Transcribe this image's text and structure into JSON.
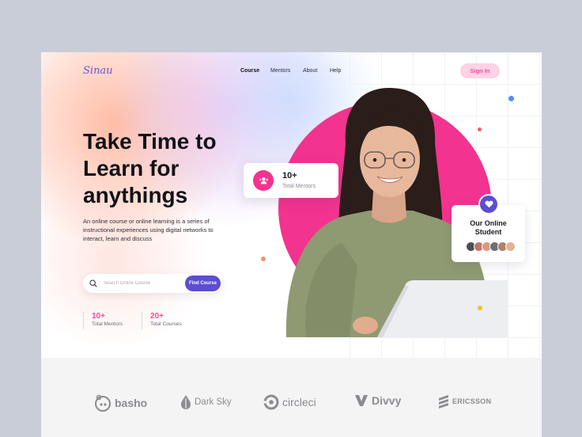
{
  "header": {
    "logo": "Sinau",
    "nav": [
      {
        "label": "Course",
        "active": true
      },
      {
        "label": "Mentors",
        "active": false
      },
      {
        "label": "About",
        "active": false
      },
      {
        "label": "Help",
        "active": false
      }
    ],
    "signin_label": "Sign In"
  },
  "hero": {
    "title_line1": "Take Time to",
    "title_line2": "Learn for",
    "title_line3": "anythings",
    "description": "An online course or online learning is a series of instructional experiences using digital networks to interact, learn and discuss"
  },
  "search": {
    "placeholder": "Search Online Course",
    "button_label": "Find Course"
  },
  "stats": [
    {
      "value": "10+",
      "label": "Total Mentors"
    },
    {
      "value": "20+",
      "label": "Total Courses"
    }
  ],
  "mentors_card": {
    "value": "10+",
    "label": "Total Mentors",
    "icon": "group-icon"
  },
  "online_card": {
    "title_line1": "Our Online",
    "title_line2": "Student",
    "icon": "heart-icon"
  },
  "brands": [
    {
      "name": "basho",
      "icon": "basho-logo"
    },
    {
      "name": "Dark Sky",
      "icon": "darksky-logo"
    },
    {
      "name": "circleci",
      "icon": "circleci-logo"
    },
    {
      "name": "Divvy",
      "icon": "divvy-logo"
    },
    {
      "name": "ERICSSON",
      "icon": "ericsson-logo"
    }
  ],
  "colors": {
    "accent_pink": "#f14b9a",
    "accent_purple": "#5b4ed2",
    "circle_pink": "#f2338f"
  }
}
